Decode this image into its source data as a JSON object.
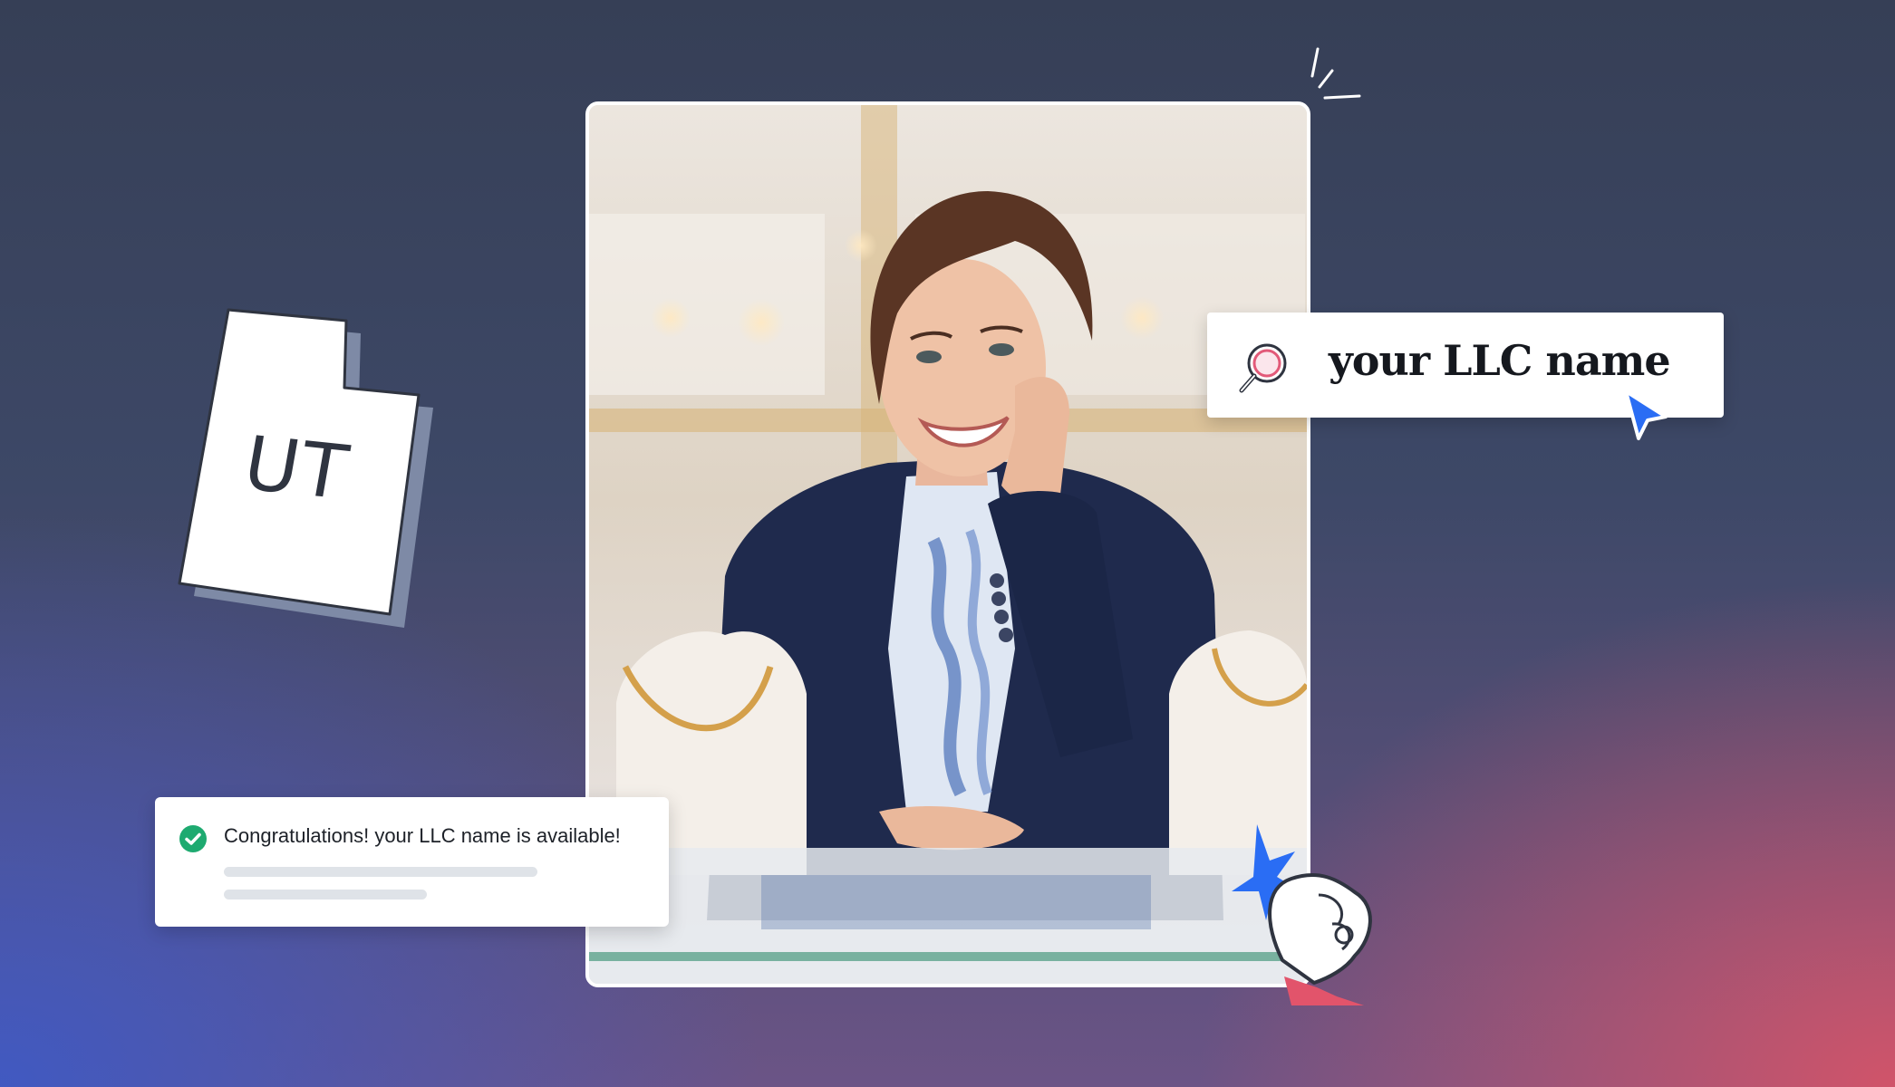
{
  "state_badge": {
    "label": "UT"
  },
  "search": {
    "query": "your LLC name"
  },
  "notification": {
    "message": "Congratulations! your LLC name is available!"
  },
  "colors": {
    "accent_blue": "#2a6df4",
    "success_green": "#1eaa70",
    "search_ring": "#e25a79",
    "hand_cuff": "#e2546b"
  },
  "icons": [
    "search-icon",
    "cursor-icon",
    "check-icon",
    "sparkle-icon",
    "hand-icon"
  ]
}
